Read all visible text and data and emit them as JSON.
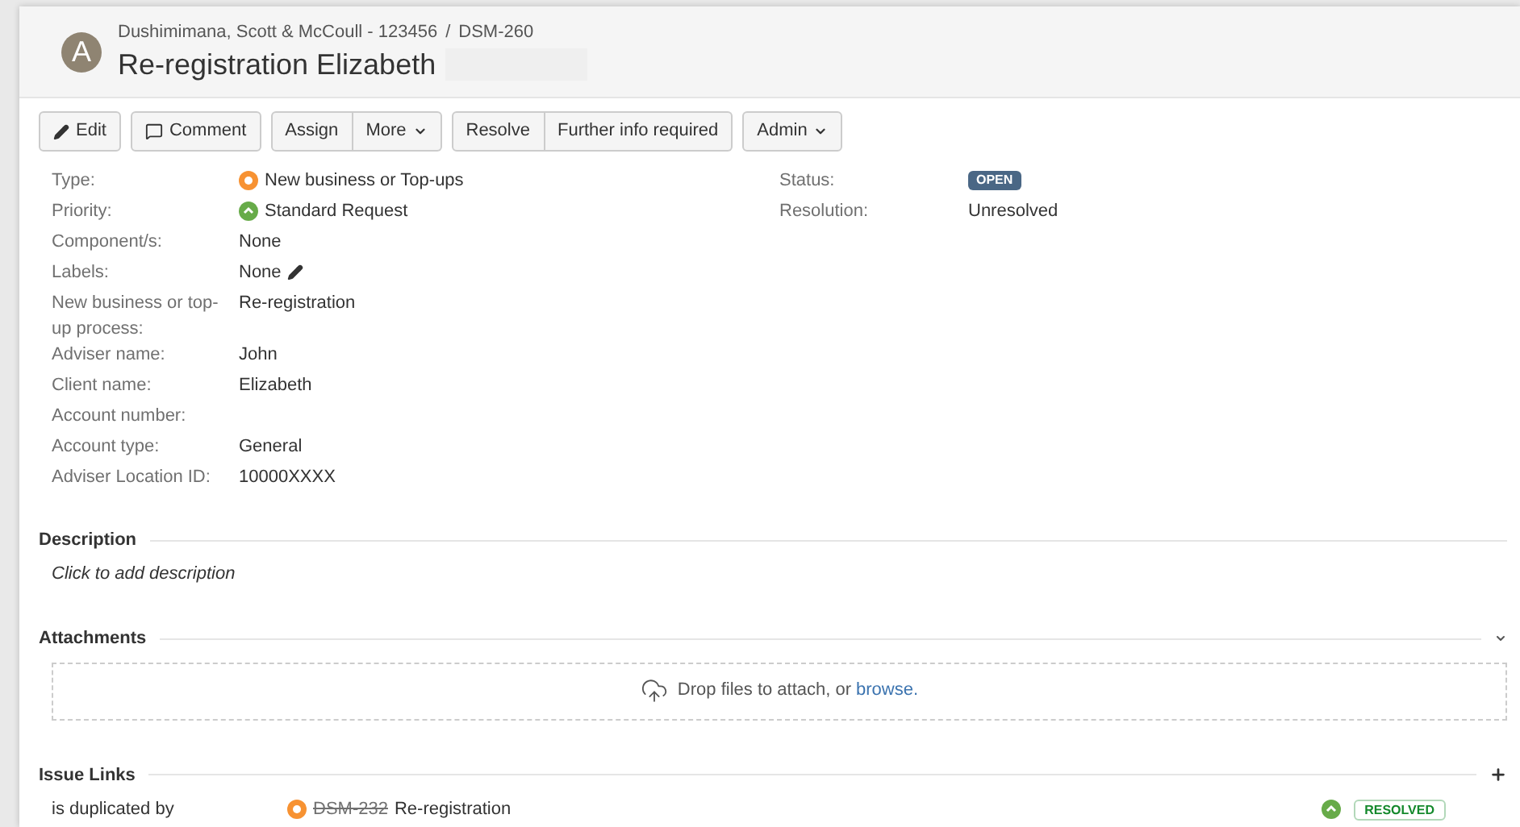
{
  "header": {
    "avatar_letter": "A",
    "breadcrumbs": [
      "Dushimimana, Scott & McCoull - 123456",
      "DSM-260"
    ],
    "separator": "/",
    "title": "Re-registration Elizabeth"
  },
  "toolbar": [
    [
      {
        "label": "Edit",
        "kind": "edit",
        "dropdown": false
      }
    ],
    [
      {
        "label": "Comment",
        "kind": "comment",
        "dropdown": false
      }
    ],
    [
      {
        "label": "Assign",
        "kind": "plain",
        "dropdown": false
      },
      {
        "label": "More",
        "kind": "plain",
        "dropdown": true
      }
    ],
    [
      {
        "label": "Resolve",
        "kind": "plain",
        "dropdown": false
      },
      {
        "label": "Further info required",
        "kind": "plain",
        "dropdown": false
      }
    ],
    [
      {
        "label": "Admin",
        "kind": "plain",
        "dropdown": true
      }
    ]
  ],
  "details": [
    {
      "label": "Type:",
      "value": "New business or Top-ups",
      "kind": "issue_type"
    },
    {
      "label": "Priority:",
      "value": "Standard Request",
      "kind": "priority"
    },
    {
      "label": "Component/s:",
      "value": "None"
    },
    {
      "label": "Labels:",
      "value": "None",
      "editable": true
    },
    {
      "label": "New business or top-up process:",
      "value": "Re-registration"
    },
    {
      "label": "Adviser name:",
      "value": "John"
    },
    {
      "label": "Client name:",
      "value": "Elizabeth"
    },
    {
      "label": "Account number:"
    },
    {
      "label": "Account type:",
      "value": "General"
    },
    {
      "label": "Adviser Location ID:",
      "value": "10000XXXX"
    }
  ],
  "people": [
    {
      "label": "Status:",
      "value": "OPEN",
      "kind": "lozenge"
    },
    {
      "label": "Resolution:",
      "value": "Unresolved",
      "kind": "text"
    }
  ],
  "description": {
    "heading": "Description",
    "placeholder": "Click to add description"
  },
  "attachments": {
    "heading": "Attachments",
    "drop_text": "Drop files to attach, or",
    "link": "browse."
  },
  "issue_links": {
    "heading": "Issue Links",
    "rows": [
      {
        "relation": "is duplicated by",
        "key": "DSM-232",
        "summary": "Re-registration",
        "resolved": true,
        "status": "RESOLVED"
      }
    ]
  }
}
